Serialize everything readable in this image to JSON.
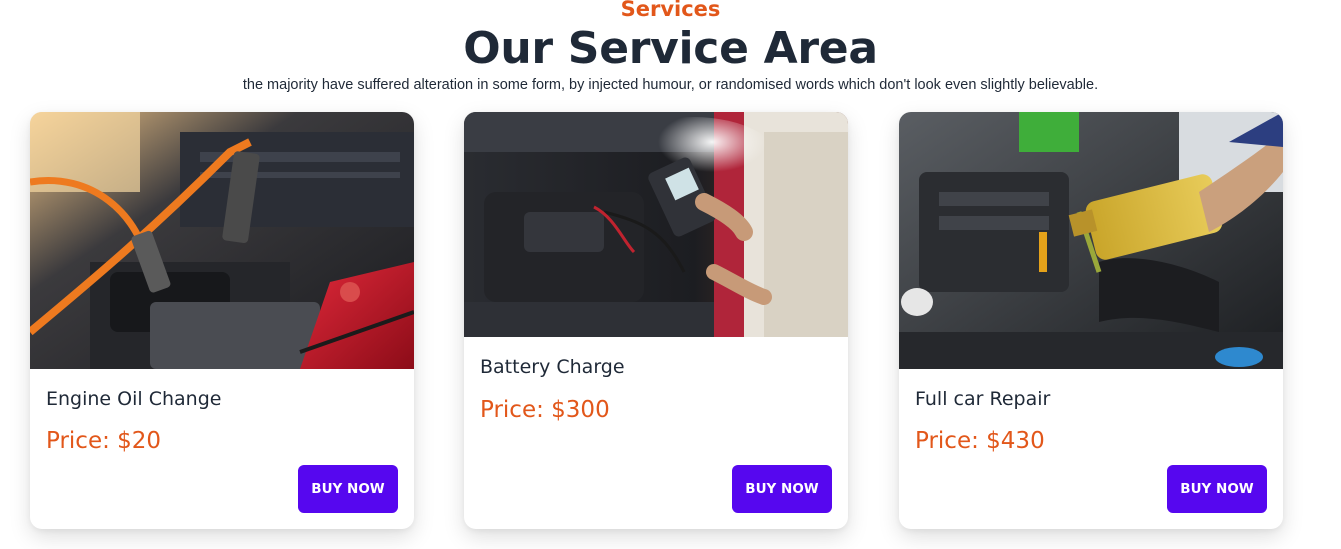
{
  "header": {
    "eyebrow": "Services",
    "title": "Our Service Area",
    "subtitle": "the majority have suffered alteration in some form, by injected humour, or randomised words which don't look even slightly believable."
  },
  "services": [
    {
      "name": "Engine Oil Change",
      "price": "Price: $20",
      "button_label": "BUY NOW",
      "image": "engine-jumper-cables-photo"
    },
    {
      "name": "Battery Charge",
      "price": "Price: $300",
      "button_label": "BUY NOW",
      "image": "battery-tester-photo"
    },
    {
      "name": "Full car Repair",
      "price": "Price: $430",
      "button_label": "BUY NOW",
      "image": "oil-pouring-photo"
    }
  ],
  "colors": {
    "accent": "#e2571a",
    "button": "#5607ef",
    "heading": "#1f2937"
  }
}
